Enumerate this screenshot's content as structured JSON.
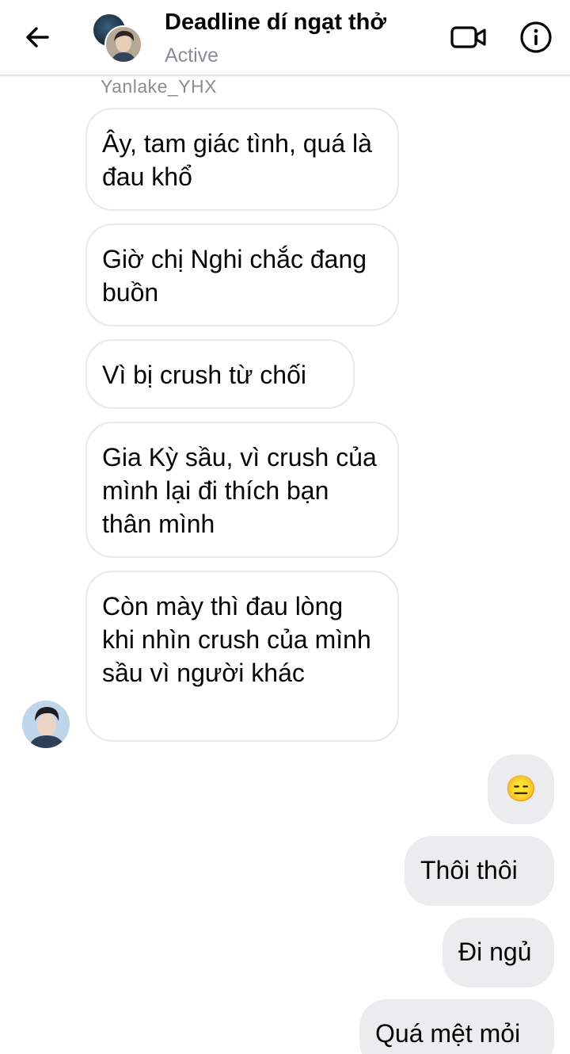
{
  "header": {
    "title": "Deadline dí ngạt thở",
    "status": "Active",
    "back_icon": "arrow-left-icon",
    "video_icon": "video-camera-icon",
    "info_icon": "info-icon"
  },
  "conversation": {
    "sender_name": "Yanlake_YHX",
    "incoming": [
      {
        "text": "Ây, tam giác tình, quá là đau khổ"
      },
      {
        "text": "Giờ chị Nghi chắc đang buồn"
      },
      {
        "text": "Vì bị crush từ chối"
      },
      {
        "text": "Gia Kỳ sầu, vì crush của mình lại đi thích bạn thân mình"
      },
      {
        "text": "Còn mày thì đau lòng khi nhìn crush của mình sầu vì người khác"
      }
    ],
    "outgoing": [
      {
        "text": "😑"
      },
      {
        "text": "Thôi thôi"
      },
      {
        "text": "Đi ngủ"
      },
      {
        "text": "Quá mệt mỏi"
      }
    ]
  },
  "colors": {
    "incoming_bubble_bg": "#ffffff",
    "incoming_bubble_border": "#e8e8ea",
    "outgoing_bubble_bg": "#ececee",
    "secondary_text": "#8a8d91"
  }
}
